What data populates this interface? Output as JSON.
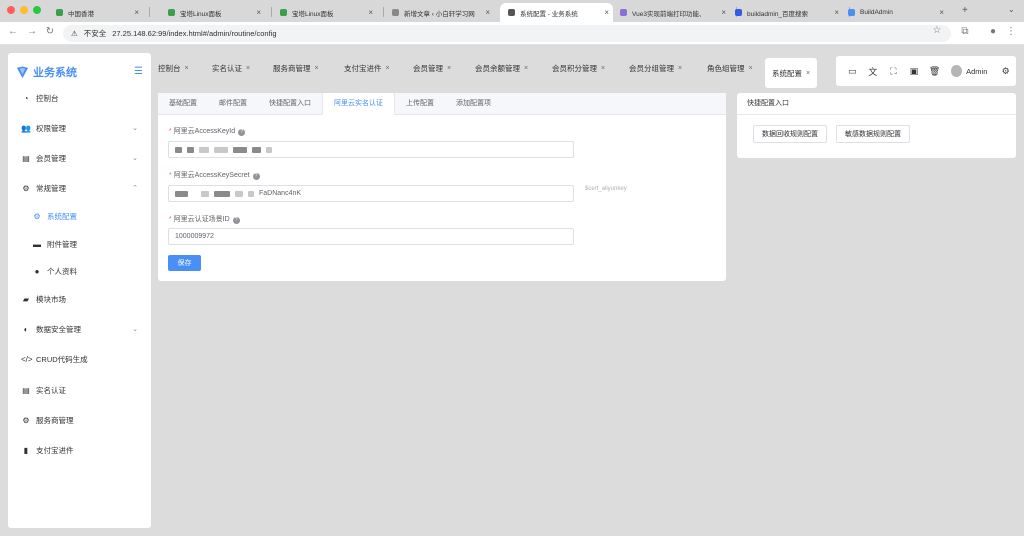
{
  "browser": {
    "tabs": [
      {
        "title": "中国香港",
        "fav": "#3a9f4a"
      },
      {
        "title": "宝塔Linux面板",
        "fav": "#3a9f4a"
      },
      {
        "title": "宝塔Linux面板",
        "fav": "#3a9f4a"
      },
      {
        "title": "新增文章 ‹ 小白轩学习网",
        "fav": "#888"
      },
      {
        "title": "系统配置 - 业务系统",
        "fav": "#555"
      },
      {
        "title": "Vue3实现前端打印功能、",
        "fav": "#8a6fd8"
      },
      {
        "title": "buildadmin_百度搜索",
        "fav": "#2f5bea"
      },
      {
        "title": "BuildAdmin",
        "fav": "#4a8ff5"
      }
    ],
    "new_tab": "+",
    "url_warning": "不安全",
    "url": "27.25.148.62:99/index.html#/admin/routine/config"
  },
  "sidebar": {
    "title": "业务系统",
    "items": [
      {
        "label": "控制台",
        "icon": "dashboard-icon",
        "glyph": "◔"
      },
      {
        "label": "权限管理",
        "icon": "users-icon",
        "glyph": "👥",
        "chev": "⌄"
      },
      {
        "label": "会员管理",
        "icon": "id-card-icon",
        "glyph": "▤",
        "chev": "⌄"
      },
      {
        "label": "常规管理",
        "icon": "gears-icon",
        "glyph": "⚙",
        "chev": "⌃"
      },
      {
        "label": "系统配置",
        "icon": "gear-icon",
        "glyph": "⚙",
        "sub": true,
        "active": true
      },
      {
        "label": "附件管理",
        "icon": "folder-icon",
        "glyph": "▬",
        "sub": true
      },
      {
        "label": "个人资料",
        "icon": "user-icon",
        "glyph": "●",
        "sub": true
      },
      {
        "label": "模块市场",
        "icon": "shop-icon",
        "glyph": "▰"
      },
      {
        "label": "数据安全管理",
        "icon": "shield-icon",
        "glyph": "◐",
        "chev": "⌄"
      },
      {
        "label": "CRUD代码生成",
        "icon": "code-icon",
        "glyph": "</>"
      },
      {
        "label": "实名认证",
        "icon": "id-card-icon",
        "glyph": "▤"
      },
      {
        "label": "服务商管理",
        "icon": "gear-icon",
        "glyph": "⚙"
      },
      {
        "label": "支付宝进件",
        "icon": "chart-icon",
        "glyph": "▮"
      }
    ]
  },
  "topnav": {
    "tabs": [
      "控制台",
      "实名认证",
      "服务商管理",
      "支付宝进件",
      "会员管理",
      "会员余额管理",
      "会员积分管理",
      "会员分组管理",
      "角色组管理",
      "系统配置"
    ],
    "close": "×",
    "username": "Admin"
  },
  "config": {
    "tabs": [
      "基础配置",
      "邮件配置",
      "快捷配置入口",
      "阿里云实名认证",
      "上传配置",
      "添加配置项"
    ],
    "fields": [
      {
        "label": "阿里云AccessKeyId",
        "value": "",
        "tip": ""
      },
      {
        "label": "阿里云AccessKeySecret",
        "value": "FaDNanc4nK",
        "tip": "$cert_aliyunkey"
      },
      {
        "label": "阿里云认证场景ID",
        "value": "1000009972",
        "tip": ""
      }
    ],
    "save": "保存"
  },
  "quick": {
    "title": "快捷配置入口",
    "buttons": [
      "数据回收规则配置",
      "敏感数据规则配置"
    ]
  }
}
